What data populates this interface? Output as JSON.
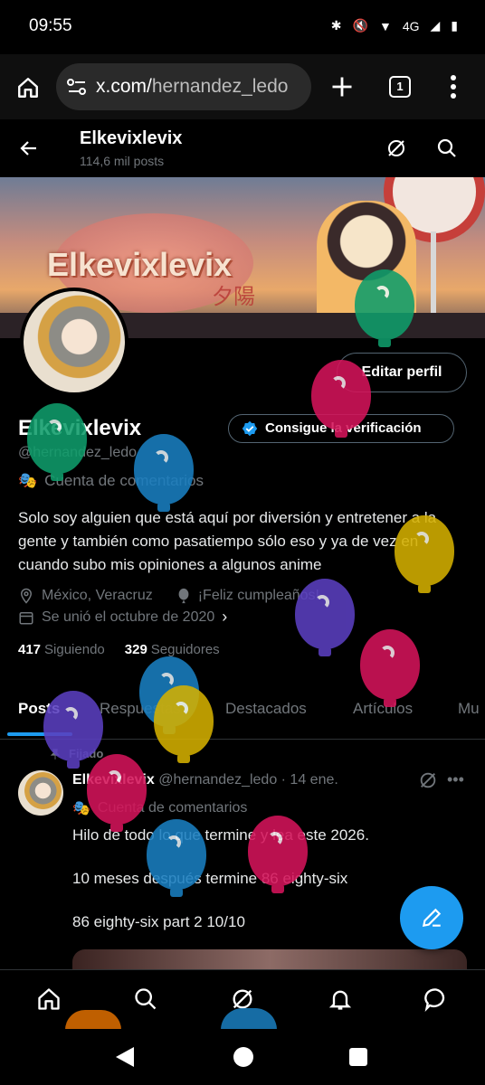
{
  "status_bar": {
    "time": "09:55",
    "network": "4G"
  },
  "browser": {
    "url_host": "x.com/",
    "url_path": "hernandez_ledo",
    "tab_count": "1"
  },
  "header": {
    "name": "Elkevixlevix",
    "posts_count": "114,6 mil posts"
  },
  "banner": {
    "title": "Elkevixlevix",
    "kanji": "夕陽"
  },
  "profile": {
    "edit_button": "Editar perfil",
    "display_name": "Elkevixlevix",
    "verify_button": "Consigue la verificación",
    "handle": "@hernandez_ledo",
    "account_type": "Cuenta de comentarios",
    "bio": "Solo soy alguien que está aquí por diversión y entretener a la gente y también como pasatiempo sólo eso y ya de vez en cuando subo mis opiniones a algunos anime",
    "location": "México, Veracruz",
    "birthday": "¡Feliz cumpleaños!",
    "joined": "Se unió el octubre de 2020",
    "following_count": "417",
    "following_label": "Siguiendo",
    "followers_count": "329",
    "followers_label": "Seguidores"
  },
  "tabs": [
    {
      "label": "Posts"
    },
    {
      "label": "Respuestas"
    },
    {
      "label": "Destacados"
    },
    {
      "label": "Artículos"
    },
    {
      "label": "Mu"
    }
  ],
  "pinned_post": {
    "pinned_label": "Fijado",
    "author": "Elkevixlevix",
    "handle_date": "@hernandez_ledo · 14 ene.",
    "account_type": "Cuenta de comentarios",
    "line1": "Hilo de todo lo que termine y lea este 2026.",
    "line2": "10 meses después termine 86 eighty-six",
    "line3": "86 eighty-six part 2 10/10"
  },
  "balloon_colors": [
    "#0f9d6b",
    "#d4145a",
    "#1a7fc1",
    "#d4b000",
    "#5a3fc0",
    "#d4145a",
    "#5a3fc0",
    "#1a7fc1",
    "#d4b000",
    "#d4145a",
    "#1a7fc1",
    "#d4145a",
    "#0f9d6b",
    "#e08a00"
  ],
  "accent_color": "#1d9bf0"
}
